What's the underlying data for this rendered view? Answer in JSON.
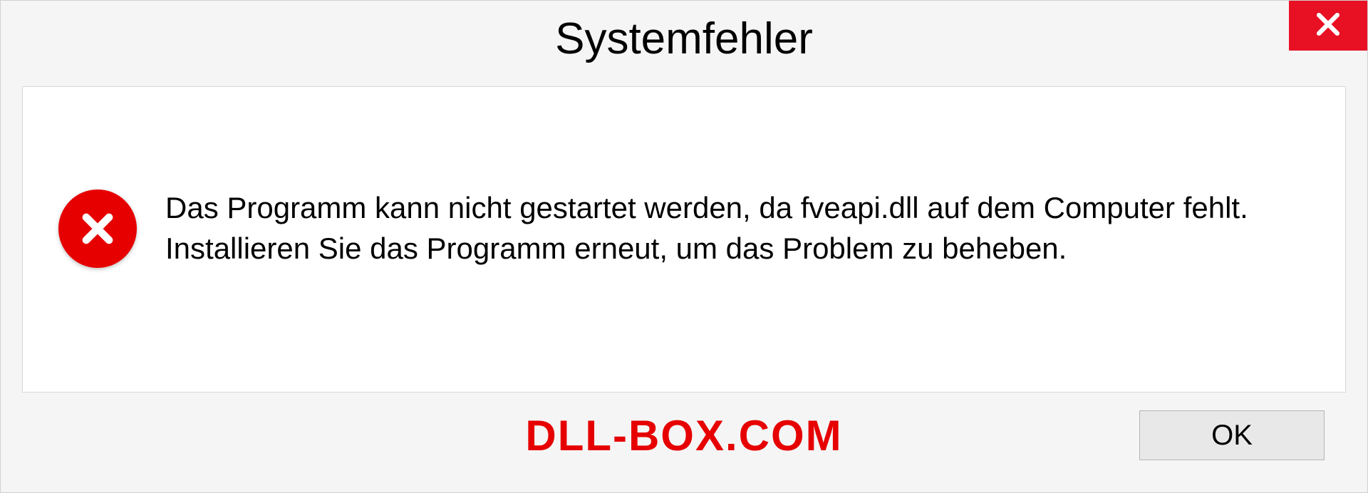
{
  "dialog": {
    "title": "Systemfehler",
    "message": "Das Programm kann nicht gestartet werden, da fveapi.dll auf dem Computer fehlt. Installieren Sie das Programm erneut, um das Problem zu beheben.",
    "ok_label": "OK"
  },
  "watermark": "DLL-BOX.COM",
  "colors": {
    "error_red": "#e60000",
    "close_red": "#e81123"
  }
}
